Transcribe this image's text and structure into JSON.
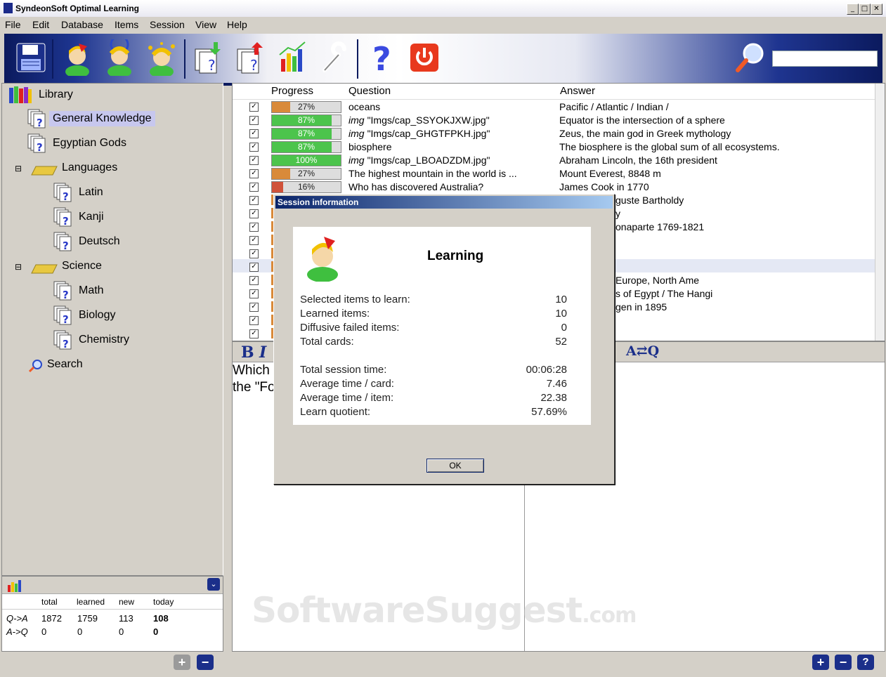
{
  "window": {
    "title": "SyndeonSoft Optimal Learning"
  },
  "menu": [
    "File",
    "Edit",
    "Database",
    "Items",
    "Session",
    "View",
    "Help"
  ],
  "toolbar": {
    "icons": [
      "save-icon",
      "learn-icon",
      "repeat-icon",
      "review-icon",
      "import-icon",
      "export-icon",
      "statistics-icon",
      "settings-icon",
      "help-icon",
      "power-icon",
      "magnifier-icon"
    ]
  },
  "tree": {
    "root": "Library",
    "items": [
      {
        "label": "General Knowledge",
        "selected": true
      },
      {
        "label": "Egyptian Gods"
      },
      {
        "label": "Languages",
        "folder": true,
        "expander": "⊟"
      },
      {
        "label": "Latin"
      },
      {
        "label": "Kanji"
      },
      {
        "label": "Deutsch"
      },
      {
        "label": "Science",
        "folder": true,
        "expander": "⊟"
      },
      {
        "label": "Math"
      },
      {
        "label": "Biology"
      },
      {
        "label": "Chemistry"
      },
      {
        "label": "Search"
      }
    ]
  },
  "stats": {
    "headers": [
      "total",
      "learned",
      "new",
      "today"
    ],
    "rows": [
      {
        "label": "Q->A",
        "total": "1872",
        "learned": "1759",
        "new": "113",
        "today": "108"
      },
      {
        "label": "A->Q",
        "total": "0",
        "learned": "0",
        "new": "0",
        "today": "0"
      }
    ]
  },
  "grid": {
    "headers": [
      "Progress",
      "Question",
      "Answer"
    ],
    "rows": [
      {
        "progress": 0.27,
        "ptext": "27%",
        "color": "#d98a3a",
        "img": "",
        "question": "oceans",
        "answer": "Pacific / Atlantic / Indian /"
      },
      {
        "progress": 0.87,
        "ptext": "87%",
        "color": "#4cc44c",
        "img": "img",
        "question": "\"Imgs/cap_SSYOKJXW.jpg\"",
        "answer": "Equator is the intersection of a sphere"
      },
      {
        "progress": 0.87,
        "ptext": "87%",
        "color": "#4cc44c",
        "img": "img",
        "question": "\"Imgs/cap_GHGTFPKH.jpg\"",
        "answer": "Zeus, the main god in Greek mythology"
      },
      {
        "progress": 0.87,
        "ptext": "87%",
        "color": "#4cc44c",
        "img": "",
        "question": "biosphere",
        "answer": "The biosphere is the global sum of all ecosystems."
      },
      {
        "progress": 1.0,
        "ptext": "100%",
        "color": "#4cc44c",
        "img": "img",
        "question": "\"Imgs/cap_LBOADZDM.jpg\"",
        "answer": "Abraham Lincoln, the 16th president"
      },
      {
        "progress": 0.27,
        "ptext": "27%",
        "color": "#d98a3a",
        "img": "",
        "question": "The highest mountain in the world is ...",
        "answer": "Mount Everest, 8848 m"
      },
      {
        "progress": 0.16,
        "ptext": "16%",
        "color": "#d0523a",
        "img": "",
        "question": "Who has discovered Australia?",
        "answer": "James Cook in 1770"
      }
    ],
    "partial_answers": [
      {
        "row": 8,
        "text": "guste Bartholdy"
      },
      {
        "row": 9,
        "text": "y"
      },
      {
        "row": 10,
        "text": "onaparte 1769-1821"
      },
      {
        "row": 14,
        "text": "Europe, North Ame"
      },
      {
        "row": 15,
        "text": "s of Egypt / The Hangi"
      },
      {
        "row": 16,
        "text": "gen in 1895"
      }
    ]
  },
  "editor": {
    "line1": "Which",
    "line2": "the \"Fo",
    "swap_label": "A⇄Q"
  },
  "dialog": {
    "title": "Session information",
    "heading": "Learning",
    "stats": [
      {
        "label": "Selected items to learn:",
        "value": "10"
      },
      {
        "label": "Learned items:",
        "value": "10"
      },
      {
        "label": "Diffusive failed items:",
        "value": "0"
      },
      {
        "label": "Total cards:",
        "value": "52"
      }
    ],
    "times": [
      {
        "label": "Total session time:",
        "value": "00:06:28"
      },
      {
        "label": "Average time / card:",
        "value": "7.46"
      },
      {
        "label": "Average time / item:",
        "value": "22.38"
      },
      {
        "label": "Learn quotient:",
        "value": "57.69%"
      }
    ],
    "ok_label": "OK"
  },
  "watermark": {
    "brand": "SoftwareSuggest",
    "tld": ".com"
  }
}
